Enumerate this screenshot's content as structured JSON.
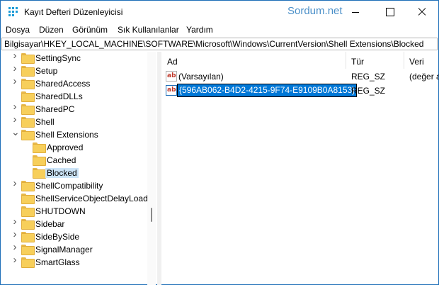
{
  "window": {
    "title": "Kayıt Defteri Düzenleyicisi",
    "watermark": "Sordum.net"
  },
  "menu": [
    "Dosya",
    "Düzen",
    "Görünüm",
    "Sık Kullanılanlar",
    "Yardım"
  ],
  "address": "Bilgisayar\\HKEY_LOCAL_MACHINE\\SOFTWARE\\Microsoft\\Windows\\CurrentVersion\\Shell Extensions\\Blocked",
  "tree": [
    {
      "label": "SettingSync",
      "expander": ">",
      "selected": false
    },
    {
      "label": "Setup",
      "expander": ">",
      "selected": false
    },
    {
      "label": "SharedAccess",
      "expander": ">",
      "selected": false
    },
    {
      "label": "SharedDLLs",
      "expander": "",
      "selected": false
    },
    {
      "label": "SharedPC",
      "expander": ">",
      "selected": false
    },
    {
      "label": "Shell",
      "expander": ">",
      "selected": false
    },
    {
      "label": "Shell Extensions",
      "expander": "v",
      "selected": false
    },
    {
      "label": "Approved",
      "expander": "",
      "selected": false
    },
    {
      "label": "Cached",
      "expander": "",
      "selected": false
    },
    {
      "label": "Blocked",
      "expander": "",
      "selected": true
    },
    {
      "label": "ShellCompatibility",
      "expander": ">",
      "selected": false
    },
    {
      "label": "ShellServiceObjectDelayLoad",
      "expander": "",
      "selected": false
    },
    {
      "label": "SHUTDOWN",
      "expander": "",
      "selected": false
    },
    {
      "label": "Sidebar",
      "expander": ">",
      "selected": false
    },
    {
      "label": "SideBySide",
      "expander": ">",
      "selected": false
    },
    {
      "label": "SignalManager",
      "expander": ">",
      "selected": false
    },
    {
      "label": "SmartGlass",
      "expander": ">",
      "selected": false
    }
  ],
  "columns": {
    "name": "Ad",
    "type": "Tür",
    "data": "Veri"
  },
  "values": [
    {
      "name": "(Varsayılan)",
      "type": "REG_SZ",
      "data": "(değer a"
    },
    {
      "name": "{596AB062-B4D2-4215-9F74-E9109B0A8153}",
      "type": "REG_SZ",
      "data": ""
    }
  ],
  "icons": {
    "value_string": "ab-icon",
    "key": "folder-icon"
  },
  "colors": {
    "selection": "#0078d7",
    "tree_selected": "#cce4f7",
    "folder": "#f7cf5b"
  }
}
